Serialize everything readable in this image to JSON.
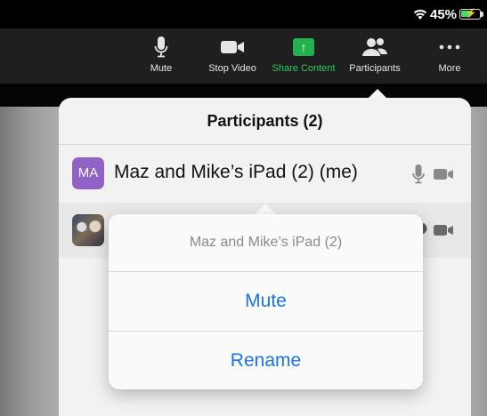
{
  "status": {
    "battery_percent": "45%"
  },
  "toolbar": {
    "items": [
      {
        "label": "Mute",
        "icon": "mic-icon"
      },
      {
        "label": "Stop Video",
        "icon": "video-camera-icon"
      },
      {
        "label": "Share Content",
        "icon": "share-arrow-icon"
      },
      {
        "label": "Participants",
        "icon": "people-icon"
      },
      {
        "label": "More",
        "icon": "ellipsis-icon"
      }
    ]
  },
  "panel": {
    "title": "Participants (2)",
    "participants": [
      {
        "initials": "MA",
        "name": "Maz and Mike’s iPad (2) (me)"
      }
    ]
  },
  "popover": {
    "title": "Maz and Mike’s iPad (2)",
    "actions": [
      "Mute",
      "Rename"
    ]
  },
  "colors": {
    "share_accent": "#22b14c",
    "avatar": "#8f62c6",
    "action_blue": "#1a73e8"
  }
}
